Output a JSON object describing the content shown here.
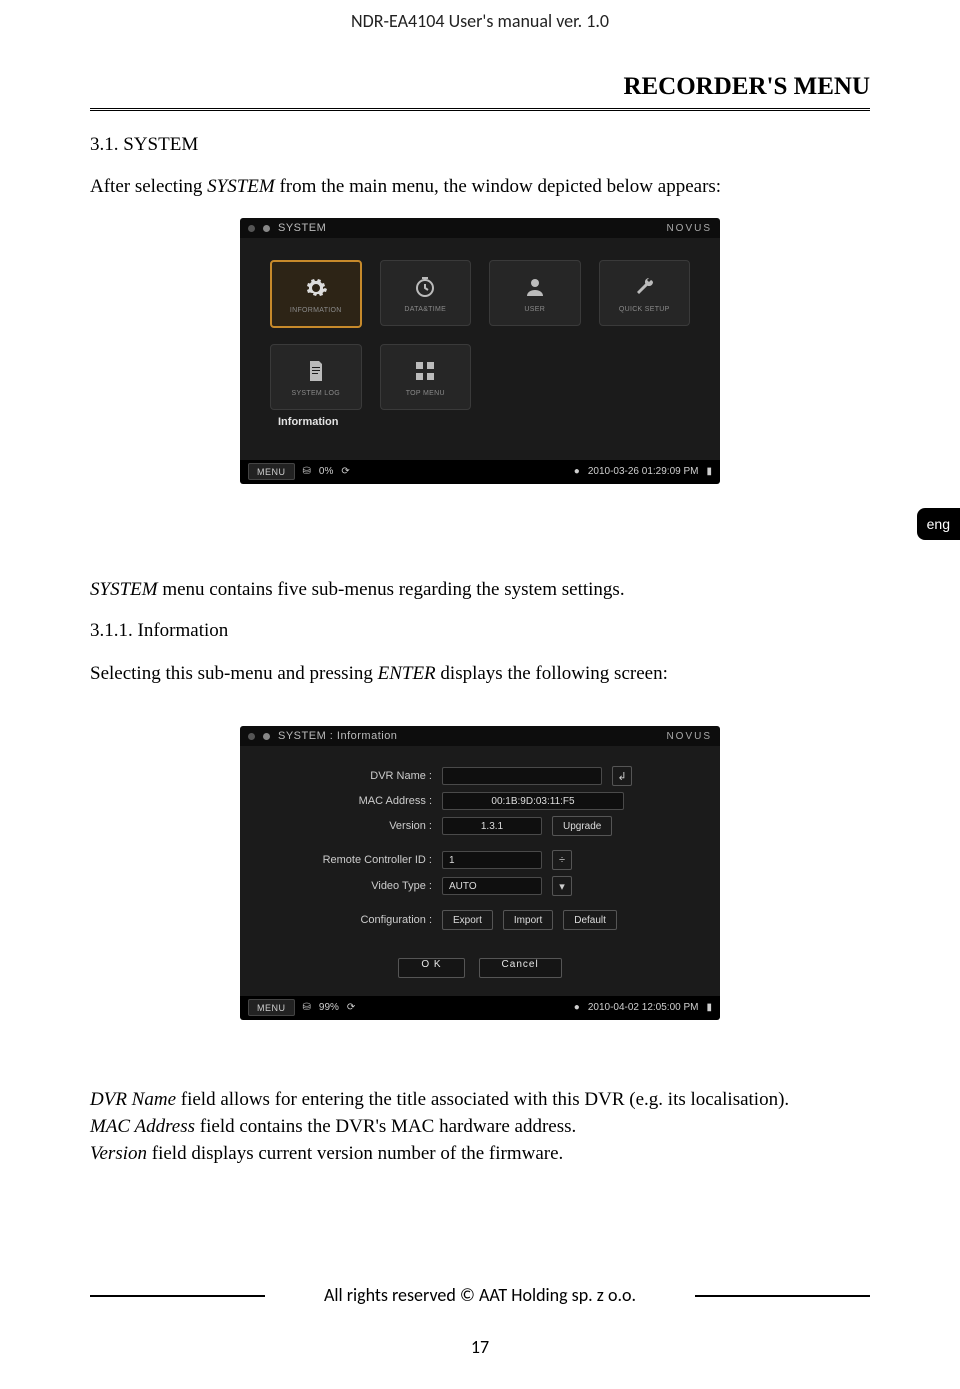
{
  "header": "NDR-EA4104 User's manual ver. 1.0",
  "section_title": "RECORDER'S MENU",
  "h31": "3.1. SYSTEM",
  "para1_a": "After selecting ",
  "para1_term": "SYSTEM",
  "para1_b": " from the main menu, the window depicted below appears:",
  "lang_tab": "eng",
  "para2_term": "SYSTEM",
  "para2_b": " menu contains five sub-menus regarding the system settings.",
  "h311": "3.1.1. Information",
  "para3_a": "Selecting this sub-menu and pressing ",
  "para3_term": "ENTER",
  "para3_b": " displays the following screen:",
  "para4_l1_term": "DVR Name",
  "para4_l1_rest": " field allows for entering the title associated with this DVR (e.g. its localisation).",
  "para4_l2_term": "MAC Address",
  "para4_l2_rest": " field contains the DVR's MAC hardware address.",
  "para4_l3_term": "Version",
  "para4_l3_rest": " field displays current version number of the firmware.",
  "footer": "All rights reserved © AAT Holding sp. z o.o.",
  "page_num": "17",
  "shot1": {
    "crumb": "SYSTEM",
    "brand": "NOVUS",
    "items": [
      {
        "label": "INFORMATION"
      },
      {
        "label": "DATA&TIME"
      },
      {
        "label": "USER"
      },
      {
        "label": "QUICK SETUP"
      },
      {
        "label": "SYSTEM LOG"
      },
      {
        "label": "TOP MENU"
      }
    ],
    "caption": "Information",
    "status": {
      "menu": "MENU",
      "pct": "0%",
      "dt": "2010-03-26 01:29:09 PM"
    }
  },
  "shot2": {
    "crumb": "SYSTEM : Information",
    "brand": "NOVUS",
    "labels": {
      "dvr_name": "DVR Name :",
      "mac": "MAC Address :",
      "version": "Version :",
      "remote_id": "Remote Controller ID :",
      "video_type": "Video Type :",
      "config": "Configuration :"
    },
    "values": {
      "dvr_name": "",
      "mac": "00:1B:9D:03:11:F5",
      "version": "1.3.1",
      "remote_id": "1",
      "video_type": "AUTO",
      "upgrade": "Upgrade",
      "export": "Export",
      "import": "Import",
      "default": "Default",
      "ok": "O K",
      "cancel": "Cancel"
    },
    "status": {
      "menu": "MENU",
      "pct": "99%",
      "dt": "2010-04-02 12:05:00 PM"
    }
  }
}
